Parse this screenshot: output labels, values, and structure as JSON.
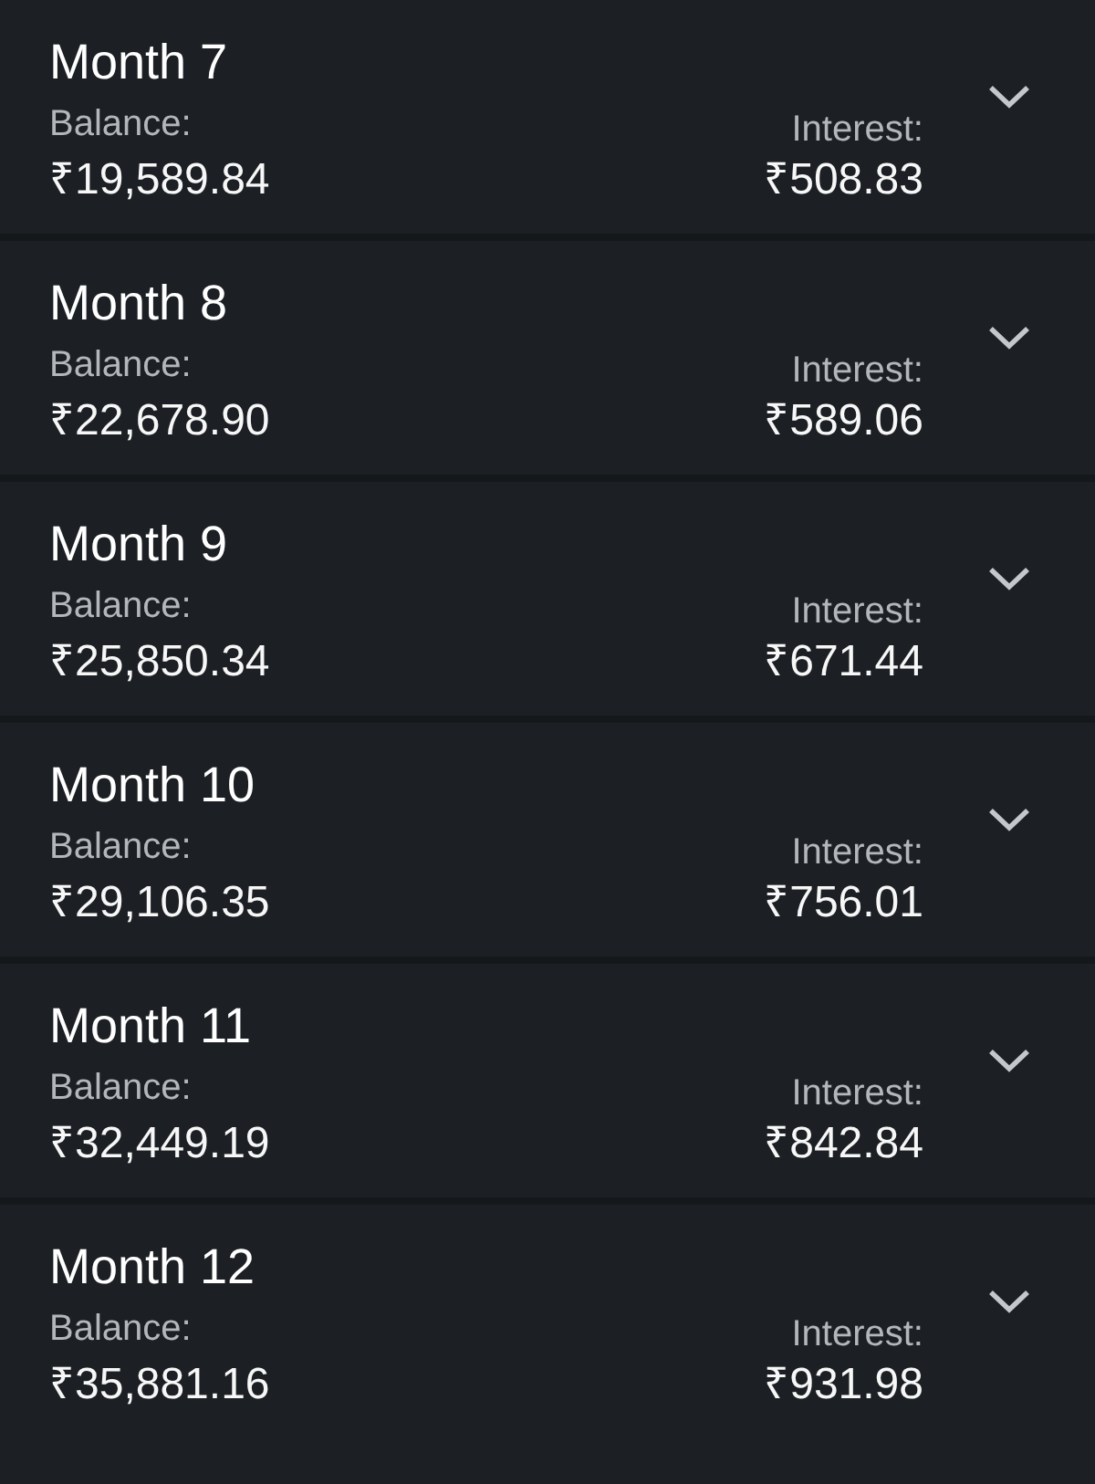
{
  "months": [
    {
      "title": "Month 7",
      "balance_label": "Balance:",
      "balance": "₹19,589.84",
      "interest_label": "Interest:",
      "interest": "₹508.83",
      "expanded": false
    },
    {
      "title": "Month 8",
      "balance_label": "Balance:",
      "balance": "₹22,678.90",
      "interest_label": "Interest:",
      "interest": "₹589.06",
      "expanded": false
    },
    {
      "title": "Month 9",
      "balance_label": "Balance:",
      "balance": "₹25,850.34",
      "interest_label": "Interest:",
      "interest": "₹671.44",
      "expanded": false
    },
    {
      "title": "Month 10",
      "balance_label": "Balance:",
      "balance": "₹29,106.35",
      "interest_label": "Interest:",
      "interest": "₹756.01",
      "expanded": false
    },
    {
      "title": "Month 11",
      "balance_label": "Balance:",
      "balance": "₹32,449.19",
      "interest_label": "Interest:",
      "interest": "₹842.84",
      "expanded": false
    },
    {
      "title": "Month 12",
      "balance_label": "Balance:",
      "balance": "₹35,881.16",
      "interest_label": "Interest:",
      "interest": "₹931.98",
      "expanded": false
    }
  ]
}
